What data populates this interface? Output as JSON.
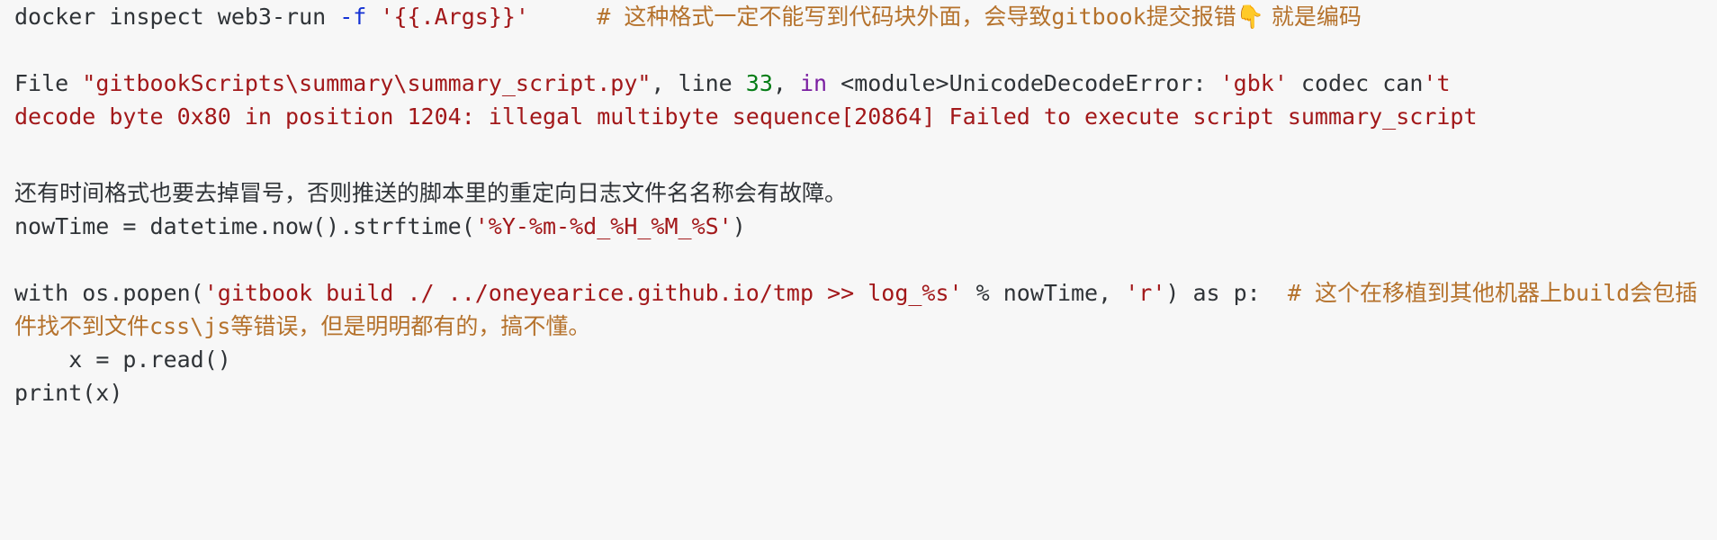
{
  "document": {
    "background_color": "#f7f7f7",
    "text_color": "#2f3337",
    "string_color": "#a2181a",
    "comment_color": "#b5722c",
    "number_color": "#067d17",
    "keyword_color": "#7a1ea1",
    "flag_color": "#1432d4",
    "emoji_color": "#e8a33d"
  },
  "lines": {
    "l1": {
      "cmd": "docker inspect web3-run ",
      "flag": "-f",
      "space": " ",
      "arg": "'{{.Args}}'",
      "gap": "     ",
      "comment_hash": "# ",
      "comment_cjk_1": "这种格式一定不能写到代码块外面，会导致",
      "comment_code": "gitbook",
      "comment_cjk_2": "提交报错",
      "emoji": "👇",
      "comment_cjk_3": " 就是编码"
    },
    "l2": {
      "file_kw": "File ",
      "path": "\"gitbookScripts\\summary\\summary_script.py\"",
      "comma_line": ", line ",
      "lineno": "33",
      "comma_in": ", ",
      "in_kw": "in",
      "module": " <module>UnicodeDecodeError: ",
      "codec": "'gbk'",
      "codec_tail": " codec can",
      "err_tail": "'t"
    },
    "l3": {
      "text": "decode byte 0x80 in position 1204: illegal multibyte sequence[20864] Failed to execute script summary_script"
    },
    "l4": {
      "cjk": "还有时间格式也要去掉冒号，否则推送的脚本里的重定向日志文件名名称会有故障。"
    },
    "l5": {
      "lhs": "nowTime = datetime.now().strftime(",
      "fmt": "'%Y-%m-%d_%H_%M_%S'",
      "rhs": ")"
    },
    "l6": {
      "head": "with os.popen(",
      "cmd_str": "'gitbook build ./ ../oneyearice.github.io/tmp >> log_%s'",
      "mid": " % nowTime, ",
      "mode": "'r'",
      "tail": ") as p:",
      "gap": "  ",
      "comment_hash": "# ",
      "comment_cjk_1": "这个在移植到其他机器上",
      "comment_code_1": "build",
      "comment_cjk_2": "会包插件找不到文件",
      "comment_code_2": "css\\js",
      "comment_cjk_3": "等错误，但是明明都有的，搞不懂。"
    },
    "l7": {
      "text": "    x = p.read()"
    },
    "l8": {
      "text": "print(x)"
    }
  }
}
